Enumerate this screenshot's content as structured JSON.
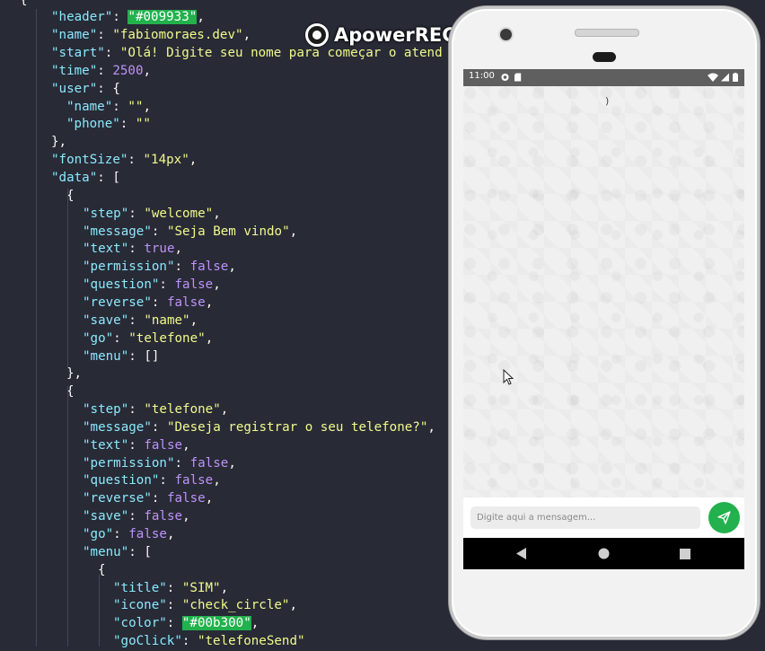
{
  "editor": {
    "lines": [
      [
        [
          "p",
          "{"
        ]
      ],
      [
        [
          "k",
          "\"header\""
        ],
        [
          "p",
          ": "
        ],
        [
          "hl",
          "\"#009933\""
        ],
        [
          "p",
          ","
        ]
      ],
      [
        [
          "k",
          "\"name\""
        ],
        [
          "p",
          ": "
        ],
        [
          "s",
          "\"fabiomoraes.dev\""
        ],
        [
          "p",
          ","
        ]
      ],
      [
        [
          "k",
          "\"start\""
        ],
        [
          "p",
          ": "
        ],
        [
          "s",
          "\"Olá! Digite seu nome para começar o atend"
        ]
      ],
      [
        [
          "k",
          "\"time\""
        ],
        [
          "p",
          ": "
        ],
        [
          "n",
          "2500"
        ],
        [
          "p",
          ","
        ]
      ],
      [
        [
          "k",
          "\"user\""
        ],
        [
          "p",
          ": {"
        ]
      ],
      [
        [
          "k",
          "\"name\""
        ],
        [
          "p",
          ": "
        ],
        [
          "s",
          "\"\""
        ],
        [
          "p",
          ","
        ]
      ],
      [
        [
          "k",
          "\"phone\""
        ],
        [
          "p",
          ": "
        ],
        [
          "s",
          "\"\""
        ]
      ],
      [
        [
          "p",
          "},"
        ]
      ],
      [
        [
          "k",
          "\"fontSize\""
        ],
        [
          "p",
          ": "
        ],
        [
          "s",
          "\"14px\""
        ],
        [
          "p",
          ","
        ]
      ],
      [
        [
          "k",
          "\"data\""
        ],
        [
          "p",
          ": ["
        ]
      ],
      [
        [
          "p",
          "{"
        ]
      ],
      [
        [
          "k",
          "\"step\""
        ],
        [
          "p",
          ": "
        ],
        [
          "s",
          "\"welcome\""
        ],
        [
          "p",
          ","
        ]
      ],
      [
        [
          "k",
          "\"message\""
        ],
        [
          "p",
          ": "
        ],
        [
          "s",
          "\"Seja Bem vindo\""
        ],
        [
          "p",
          ","
        ]
      ],
      [
        [
          "k",
          "\"text\""
        ],
        [
          "p",
          ": "
        ],
        [
          "n",
          "true"
        ],
        [
          "p",
          ","
        ]
      ],
      [
        [
          "k",
          "\"permission\""
        ],
        [
          "p",
          ": "
        ],
        [
          "n",
          "false"
        ],
        [
          "p",
          ","
        ]
      ],
      [
        [
          "k",
          "\"question\""
        ],
        [
          "p",
          ": "
        ],
        [
          "n",
          "false"
        ],
        [
          "p",
          ","
        ]
      ],
      [
        [
          "k",
          "\"reverse\""
        ],
        [
          "p",
          ": "
        ],
        [
          "n",
          "false"
        ],
        [
          "p",
          ","
        ]
      ],
      [
        [
          "k",
          "\"save\""
        ],
        [
          "p",
          ": "
        ],
        [
          "s",
          "\"name\""
        ],
        [
          "p",
          ","
        ]
      ],
      [
        [
          "k",
          "\"go\""
        ],
        [
          "p",
          ": "
        ],
        [
          "s",
          "\"telefone\""
        ],
        [
          "p",
          ","
        ]
      ],
      [
        [
          "k",
          "\"menu\""
        ],
        [
          "p",
          ": []"
        ]
      ],
      [
        [
          "p",
          "},"
        ]
      ],
      [
        [
          "p",
          "{"
        ]
      ],
      [
        [
          "k",
          "\"step\""
        ],
        [
          "p",
          ": "
        ],
        [
          "s",
          "\"telefone\""
        ],
        [
          "p",
          ","
        ]
      ],
      [
        [
          "k",
          "\"message\""
        ],
        [
          "p",
          ": "
        ],
        [
          "s",
          "\"Deseja registrar o seu telefone?\""
        ],
        [
          "p",
          ","
        ]
      ],
      [
        [
          "k",
          "\"text\""
        ],
        [
          "p",
          ": "
        ],
        [
          "n",
          "false"
        ],
        [
          "p",
          ","
        ]
      ],
      [
        [
          "k",
          "\"permission\""
        ],
        [
          "p",
          ": "
        ],
        [
          "n",
          "false"
        ],
        [
          "p",
          ","
        ]
      ],
      [
        [
          "k",
          "\"question\""
        ],
        [
          "p",
          ": "
        ],
        [
          "n",
          "false"
        ],
        [
          "p",
          ","
        ]
      ],
      [
        [
          "k",
          "\"reverse\""
        ],
        [
          "p",
          ": "
        ],
        [
          "n",
          "false"
        ],
        [
          "p",
          ","
        ]
      ],
      [
        [
          "k",
          "\"save\""
        ],
        [
          "p",
          ": "
        ],
        [
          "n",
          "false"
        ],
        [
          "p",
          ","
        ]
      ],
      [
        [
          "k",
          "\"go\""
        ],
        [
          "p",
          ": "
        ],
        [
          "n",
          "false"
        ],
        [
          "p",
          ","
        ]
      ],
      [
        [
          "k",
          "\"menu\""
        ],
        [
          "p",
          ": ["
        ]
      ],
      [
        [
          "p",
          "{"
        ]
      ],
      [
        [
          "k",
          "\"title\""
        ],
        [
          "p",
          ": "
        ],
        [
          "s",
          "\"SIM\""
        ],
        [
          "p",
          ","
        ]
      ],
      [
        [
          "k",
          "\"icone\""
        ],
        [
          "p",
          ": "
        ],
        [
          "s",
          "\"check_circle\""
        ],
        [
          "p",
          ","
        ]
      ],
      [
        [
          "k",
          "\"color\""
        ],
        [
          "p",
          ": "
        ],
        [
          "hl",
          "\"#00b300\""
        ],
        [
          "p",
          ","
        ]
      ],
      [
        [
          "k",
          "\"goClick\""
        ],
        [
          "p",
          ": "
        ],
        [
          "s",
          "\"telefoneSend\""
        ]
      ]
    ]
  },
  "watermark": {
    "text": "ApowerREC"
  },
  "phone": {
    "status_time": "11:00",
    "typing_indicator": ")",
    "input_placeholder": "Digite aqui a mensagem...",
    "send_icon": "send-icon",
    "accent_color": "#22b14c",
    "nav_icons": [
      "back-icon",
      "home-icon",
      "recents-icon"
    ]
  }
}
